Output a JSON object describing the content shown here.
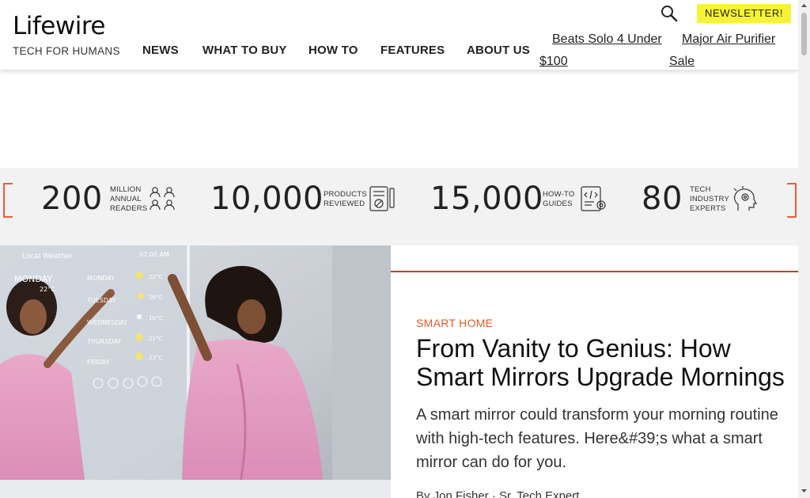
{
  "header": {
    "logo": "Lifewire",
    "tagline": "TECH FOR HUMANS",
    "nav": [
      "NEWS",
      "WHAT TO BUY",
      "HOW TO",
      "FEATURES",
      "ABOUT US"
    ],
    "trending": [
      {
        "line1": "Beats Solo 4 Under",
        "line2": "$100"
      },
      {
        "line1": "Major Air Purifier",
        "line2": "Sale"
      }
    ],
    "newsletter_label": "NEWSLETTER!"
  },
  "stats": [
    {
      "number": "200",
      "label": [
        "MILLION",
        "ANNUAL",
        "READERS"
      ],
      "icon": "readers-icon"
    },
    {
      "number": "10,000",
      "label": [
        "PRODUCTS",
        "REVIEWED"
      ],
      "icon": "products-reviewed-icon"
    },
    {
      "number": "15,000",
      "label": [
        "HOW-TO",
        "GUIDES"
      ],
      "icon": "guides-icon"
    },
    {
      "number": "80",
      "label": [
        "TECH",
        "INDUSTRY",
        "EXPERTS"
      ],
      "icon": "experts-icon"
    }
  ],
  "hero": {
    "image_text": {
      "location": "Local Weather",
      "time": "07:00 AM",
      "today": "MONDAY",
      "today_temp": "22°C",
      "days": [
        "MONDAY",
        "TUESDAY",
        "WEDNESDAY",
        "THURSDAY",
        "FRIDAY"
      ],
      "temps": [
        "22°C",
        "26°C",
        "16°C",
        "21°C",
        "23°C"
      ]
    },
    "kicker": "SMART HOME",
    "headline": "From Vanity to Genius: How Smart Mirrors Upgrade Mornings",
    "summary": "A smart mirror could transform your morning routine with high-tech features. Here&#39;s what a smart mirror can do for you.",
    "byline": "By Jon Fisher · Sr. Tech Expert"
  },
  "colors": {
    "accent": "#e25a2b",
    "newsletter_bg": "#f6f432",
    "stats_bg": "#f2f2f2"
  }
}
